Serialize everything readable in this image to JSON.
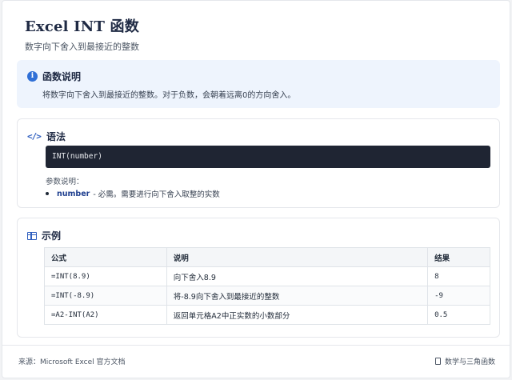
{
  "header": {
    "title": "Excel INT 函数",
    "subtitle": "数字向下舍入到最接近的整数"
  },
  "info": {
    "title": "函数说明",
    "text": "将数字向下舍入到最接近的整数。对于负数，会朝着远离0的方向舍入。"
  },
  "syntax": {
    "title": "语法",
    "code": "INT(number)",
    "params_label": "参数说明：",
    "params": [
      {
        "name": "number",
        "desc": "- 必需。需要进行向下舍入取整的实数"
      }
    ]
  },
  "examples": {
    "title": "示例",
    "headers": [
      "公式",
      "说明",
      "结果"
    ],
    "rows": [
      {
        "formula": "=INT(8.9)",
        "desc": "向下舍入8.9",
        "result": "8"
      },
      {
        "formula": "=INT(-8.9)",
        "desc": "将-8.9向下舍入到最接近的整数",
        "result": "-9"
      },
      {
        "formula": "=A2-INT(A2)",
        "desc": "返回单元格A2中正实数的小数部分",
        "result": "0.5"
      }
    ]
  },
  "footer": {
    "source": "来源：Microsoft Excel 官方文档",
    "category": "数学与三角函数"
  },
  "colors": {
    "accent": "#2f6fd6",
    "info_bg": "#eef4fd",
    "code_bg": "#1f2533"
  }
}
